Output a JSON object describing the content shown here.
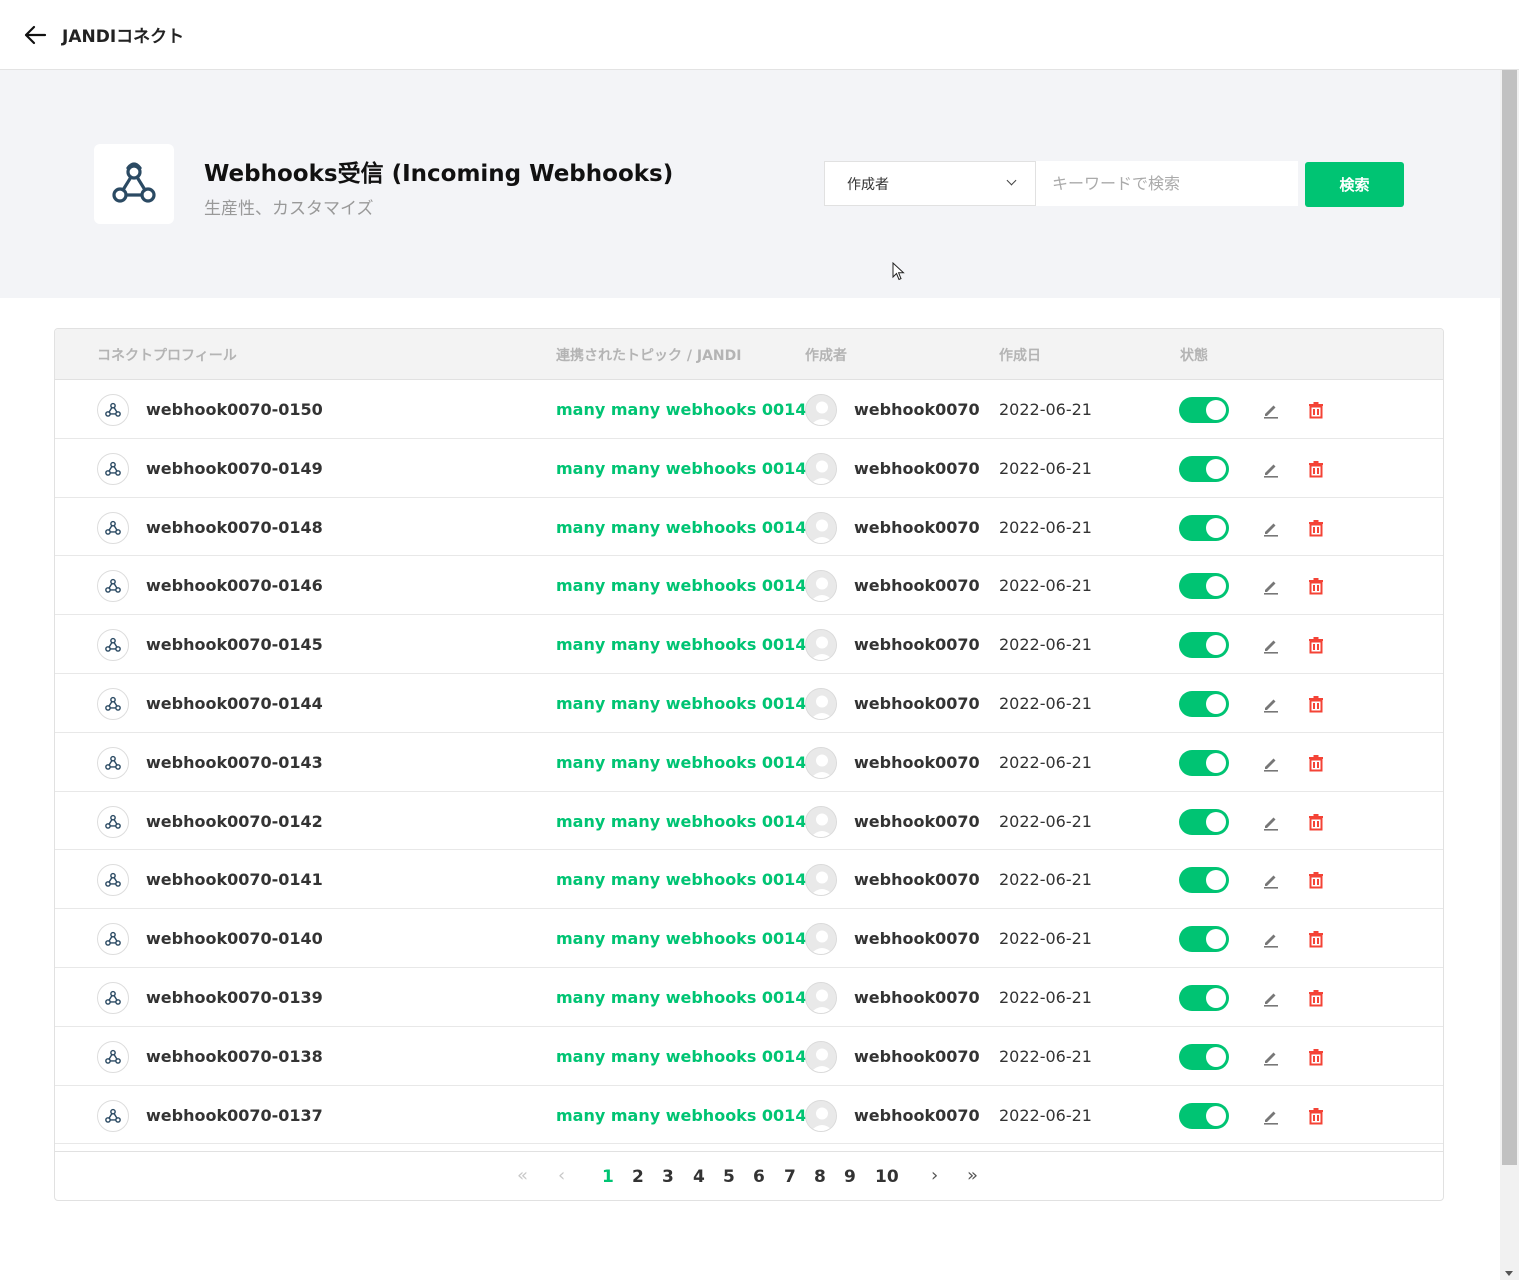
{
  "topbar": {
    "title": "JANDIコネクト"
  },
  "app": {
    "title": "Webhooks受信 (Incoming Webhooks)",
    "subtitle": "生産性、カスタマイズ"
  },
  "search": {
    "filter_value": "作成者",
    "placeholder": "キーワードで検索",
    "button_label": "検索"
  },
  "table": {
    "headers": {
      "profile": "コネクトプロフィール",
      "topic": "連携されたトピック / JANDI",
      "creator": "作成者",
      "date": "作成日",
      "status": "状態"
    },
    "rows": [
      {
        "name": "webhook0070-0150",
        "topic": "many many webhooks 0014",
        "creator": "webhook0070",
        "date": "2022-06-21"
      },
      {
        "name": "webhook0070-0149",
        "topic": "many many webhooks 0014",
        "creator": "webhook0070",
        "date": "2022-06-21"
      },
      {
        "name": "webhook0070-0148",
        "topic": "many many webhooks 0014",
        "creator": "webhook0070",
        "date": "2022-06-21"
      },
      {
        "name": "webhook0070-0146",
        "topic": "many many webhooks 0014",
        "creator": "webhook0070",
        "date": "2022-06-21"
      },
      {
        "name": "webhook0070-0145",
        "topic": "many many webhooks 0014",
        "creator": "webhook0070",
        "date": "2022-06-21"
      },
      {
        "name": "webhook0070-0144",
        "topic": "many many webhooks 0014",
        "creator": "webhook0070",
        "date": "2022-06-21"
      },
      {
        "name": "webhook0070-0143",
        "topic": "many many webhooks 0014",
        "creator": "webhook0070",
        "date": "2022-06-21"
      },
      {
        "name": "webhook0070-0142",
        "topic": "many many webhooks 0014",
        "creator": "webhook0070",
        "date": "2022-06-21"
      },
      {
        "name": "webhook0070-0141",
        "topic": "many many webhooks 0014",
        "creator": "webhook0070",
        "date": "2022-06-21"
      },
      {
        "name": "webhook0070-0140",
        "topic": "many many webhooks 0014",
        "creator": "webhook0070",
        "date": "2022-06-21"
      },
      {
        "name": "webhook0070-0139",
        "topic": "many many webhooks 0014",
        "creator": "webhook0070",
        "date": "2022-06-21"
      },
      {
        "name": "webhook0070-0138",
        "topic": "many many webhooks 0014",
        "creator": "webhook0070",
        "date": "2022-06-21"
      },
      {
        "name": "webhook0070-0137",
        "topic": "many many webhooks 0014",
        "creator": "webhook0070",
        "date": "2022-06-21"
      }
    ]
  },
  "pagination": {
    "pages": [
      "1",
      "2",
      "3",
      "4",
      "5",
      "6",
      "7",
      "8",
      "9",
      "10"
    ],
    "current": "1",
    "first": "«",
    "prev": "‹",
    "next": "›",
    "last": "»"
  },
  "colors": {
    "accent": "#00c473",
    "danger": "#f44336"
  }
}
